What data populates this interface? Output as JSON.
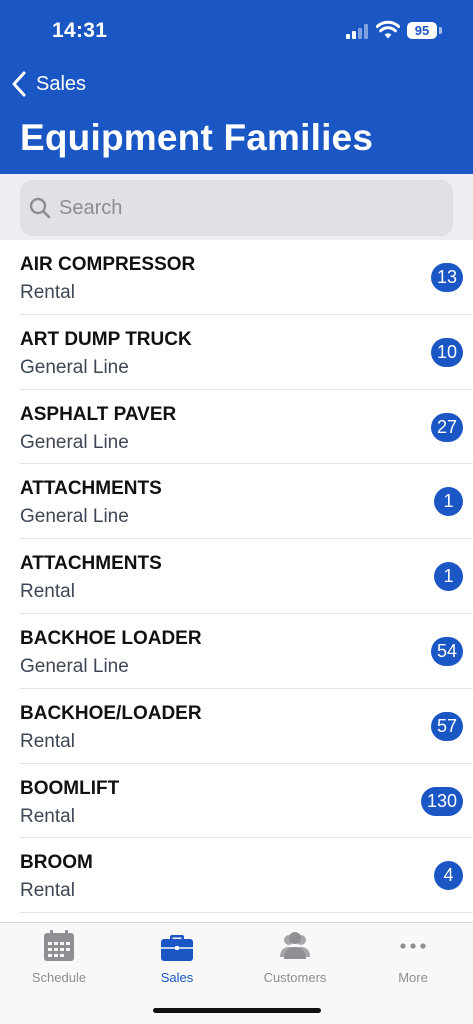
{
  "status_bar": {
    "time": "14:31",
    "battery": "95"
  },
  "nav": {
    "back_label": "Sales",
    "title": "Equipment Families"
  },
  "search": {
    "placeholder": "Search"
  },
  "items": [
    {
      "title": "AIR COMPRESSOR",
      "subtitle": "Rental",
      "count": "13"
    },
    {
      "title": "ART DUMP TRUCK",
      "subtitle": "General Line",
      "count": "10"
    },
    {
      "title": "ASPHALT PAVER",
      "subtitle": "General Line",
      "count": "27"
    },
    {
      "title": "ATTACHMENTS",
      "subtitle": "General Line",
      "count": "1"
    },
    {
      "title": "ATTACHMENTS",
      "subtitle": "Rental",
      "count": "1"
    },
    {
      "title": "BACKHOE LOADER",
      "subtitle": "General Line",
      "count": "54"
    },
    {
      "title": "BACKHOE/LOADER",
      "subtitle": "Rental",
      "count": "57"
    },
    {
      "title": "BOOMLIFT",
      "subtitle": "Rental",
      "count": "130"
    },
    {
      "title": "BROOM",
      "subtitle": "Rental",
      "count": "4"
    }
  ],
  "tabs": [
    {
      "label": "Schedule",
      "icon": "calendar-icon"
    },
    {
      "label": "Sales",
      "icon": "briefcase-icon",
      "active": true
    },
    {
      "label": "Customers",
      "icon": "people-icon"
    },
    {
      "label": "More",
      "icon": "ellipsis-icon"
    }
  ],
  "colors": {
    "primary": "#1a56c4",
    "tab_inactive": "#8e8e93"
  }
}
